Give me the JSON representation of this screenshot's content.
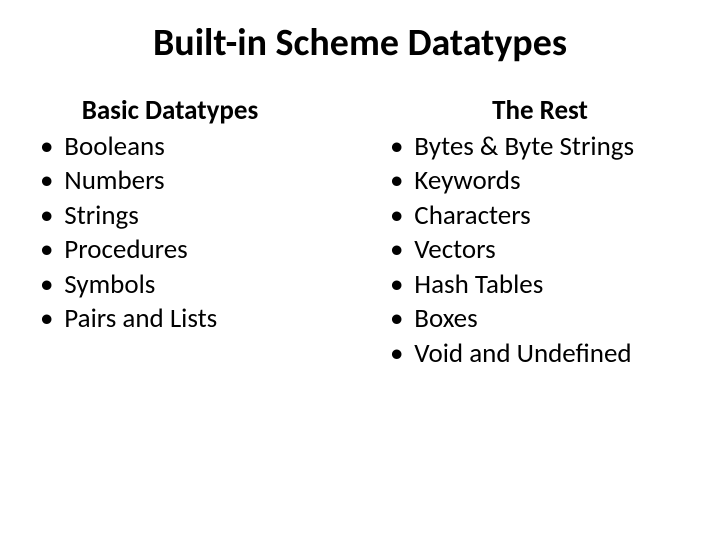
{
  "title": "Built-in Scheme Datatypes",
  "left": {
    "heading": "Basic Datatypes",
    "items": [
      "Booleans",
      "Numbers",
      "Strings",
      "Procedures",
      "Symbols",
      "Pairs and Lists"
    ]
  },
  "right": {
    "heading": "The Rest",
    "items": [
      "Bytes & Byte Strings",
      "Keywords",
      "Characters",
      "Vectors",
      "Hash Tables",
      "Boxes",
      "Void and Undefined"
    ]
  },
  "bullet_char": "•"
}
